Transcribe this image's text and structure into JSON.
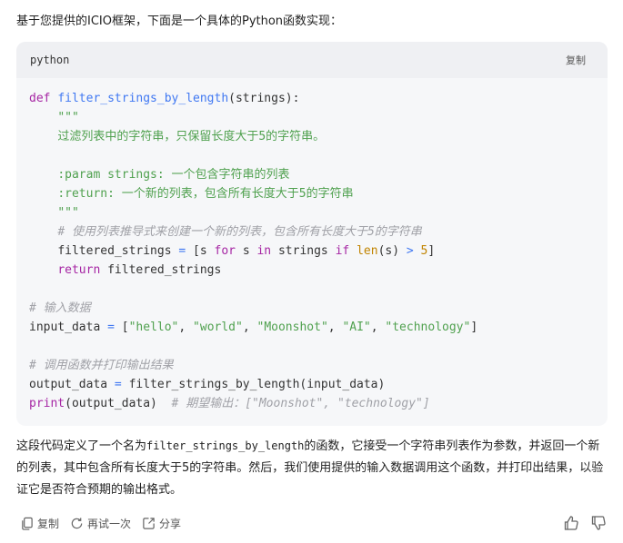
{
  "intro_text": "基于您提供的ICIO框架，下面是一个具体的Python函数实现：",
  "code_block": {
    "language": "python",
    "copy_label": "复制",
    "tokens": {
      "def": "def",
      "func_name": "filter_strings_by_length",
      "params": "(strings):",
      "doc_open": "\"\"\"",
      "doc_line1": "过滤列表中的字符串，只保留长度大于5的字符串。",
      "doc_param": ":param strings: 一个包含字符串的列表",
      "doc_return": ":return: 一个新的列表，包含所有长度大于5的字符串",
      "doc_close": "\"\"\"",
      "comment1": "# 使用列表推导式来创建一个新的列表，包含所有长度大于5的字符串",
      "fs_var": "filtered_strings",
      "eq": "=",
      "bracket_open": "[s",
      "for": "for",
      "s_var": "s",
      "in": "in",
      "strings_var": "strings",
      "if": "if",
      "len": "len",
      "len_arg": "(s)",
      "gt": ">",
      "five": "5",
      "bracket_close": "]",
      "return": "return",
      "return_val": "filtered_strings",
      "comment2": "# 输入数据",
      "input_var": "input_data",
      "list_open": "[",
      "s_hello": "\"hello\"",
      "s_world": "\"world\"",
      "s_moonshot": "\"Moonshot\"",
      "s_ai": "\"AI\"",
      "s_tech": "\"technology\"",
      "list_close": "]",
      "comment3": "# 调用函数并打印输出结果",
      "output_var": "output_data",
      "call": "filter_strings_by_length(input_data)",
      "print": "print",
      "print_arg": "(output_data)",
      "comment4": "# 期望输出：[\"Moonshot\", \"technology\"]"
    }
  },
  "explanation": {
    "part1": "这段代码定义了一个名为",
    "code_name": "filter_strings_by_length",
    "part2": "的函数，它接受一个字符串列表作为参数，并返回一个新的列表，其中包含所有长度大于5的字符串。然后，我们使用提供的输入数据调用这个函数，并打印出结果，以验证它是否符合预期的输出格式。"
  },
  "actions": {
    "copy": "复制",
    "retry": "再试一次",
    "share": "分享",
    "icons": [
      "copy-icon",
      "retry-icon",
      "share-icon",
      "thumbs-up-icon",
      "thumbs-down-icon"
    ]
  },
  "colors": {
    "keyword": "#a626a4",
    "function": "#4078f2",
    "string": "#50a14f",
    "comment": "#a0a1a7",
    "number": "#c18401",
    "code_bg": "#f6f7f9"
  }
}
